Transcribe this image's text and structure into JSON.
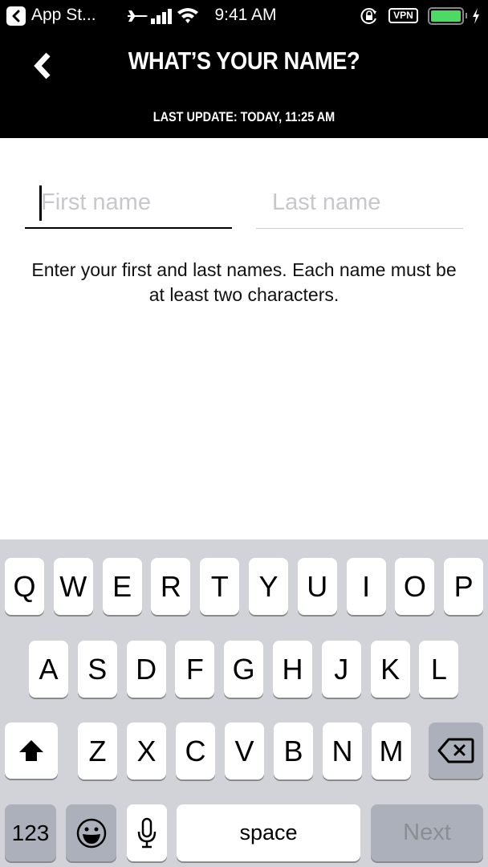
{
  "status_bar": {
    "back_app": "App St...",
    "time": "9:41 AM",
    "vpn": "VPN",
    "battery_percent": 100,
    "battery_color": "#4cd964",
    "icons": [
      "back-to-app-icon",
      "airplane-icon",
      "signal-icon",
      "wifi-icon",
      "rotation-lock-icon",
      "vpn-icon",
      "battery-icon",
      "charging-bolt-icon"
    ]
  },
  "nav": {
    "title": "WHAT’S YOUR NAME?",
    "subtitle": "LAST UPDATE: TODAY, 11:25 AM",
    "back_icon": "chevron-left-icon"
  },
  "form": {
    "first_name": {
      "value": "",
      "placeholder": "First name",
      "focused": true
    },
    "last_name": {
      "value": "",
      "placeholder": "Last name",
      "focused": false
    },
    "hint": "Enter your first and last names. Each name must be at least two characters."
  },
  "keyboard": {
    "row1": [
      "Q",
      "W",
      "E",
      "R",
      "T",
      "Y",
      "U",
      "I",
      "O",
      "P"
    ],
    "row2": [
      "A",
      "S",
      "D",
      "F",
      "G",
      "H",
      "J",
      "K",
      "L"
    ],
    "row3": [
      "Z",
      "X",
      "C",
      "V",
      "B",
      "N",
      "M"
    ],
    "shift_icon": "shift-arrow-icon",
    "delete_icon": "backspace-icon",
    "numbers_label": "123",
    "emoji_icon": "emoji-icon",
    "mic_icon": "microphone-icon",
    "space_label": "space",
    "return_label": "Next"
  }
}
